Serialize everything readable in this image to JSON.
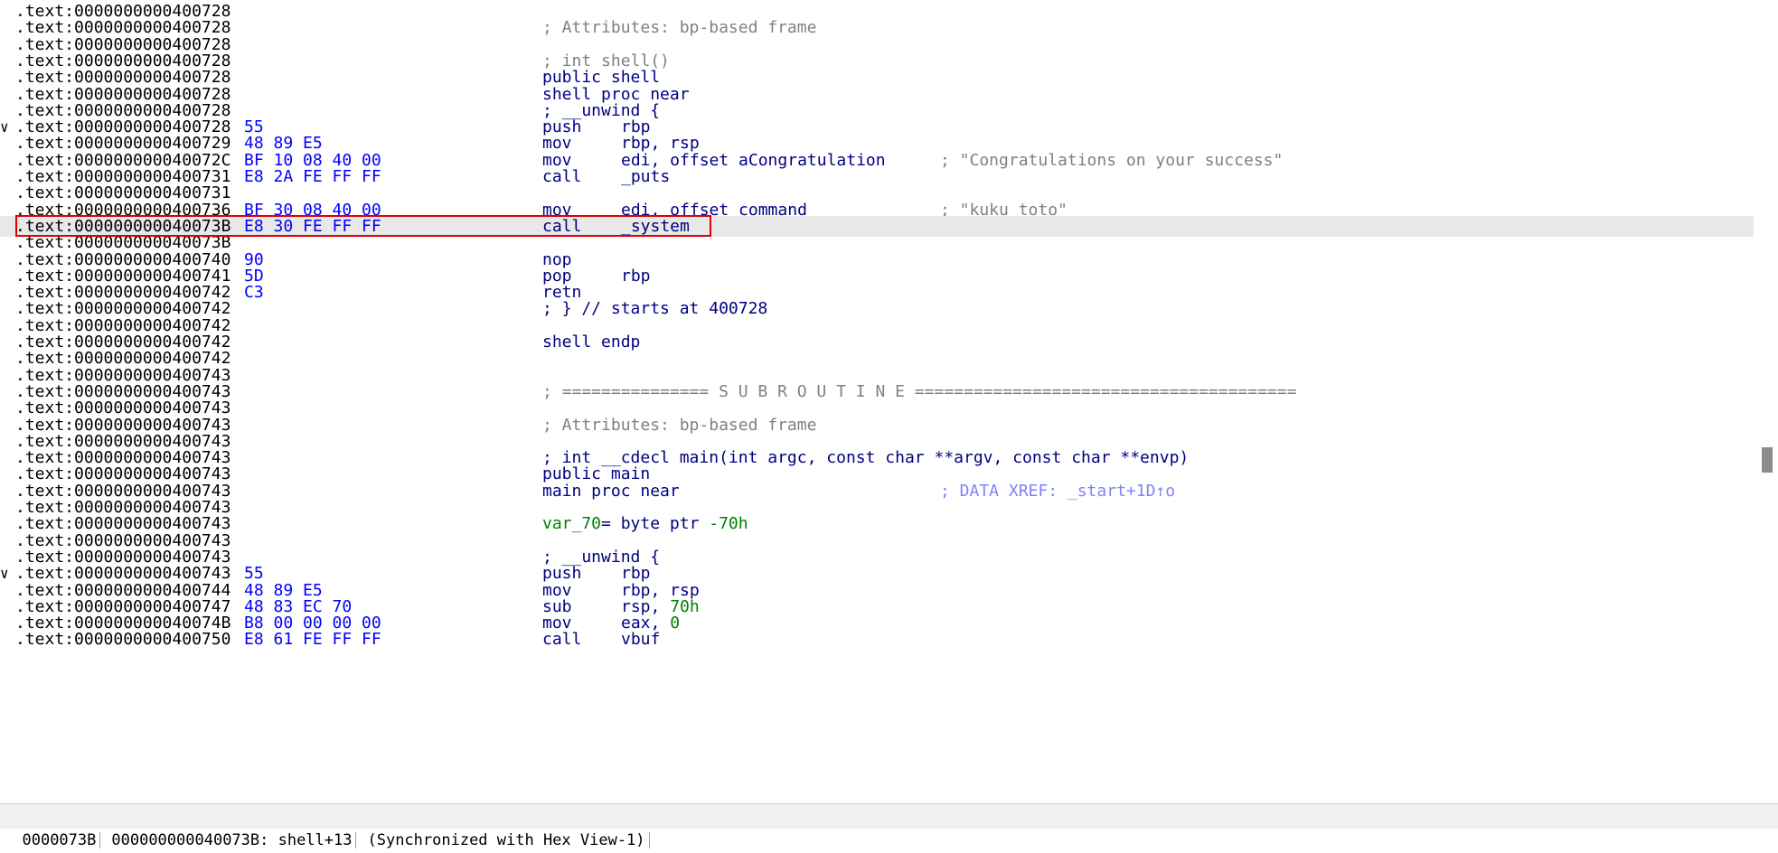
{
  "listing": [
    {
      "addr": ".text:0000000000400728",
      "kind": "blank"
    },
    {
      "addr": ".text:0000000000400728",
      "kind": "comment",
      "text": "; Attributes: bp-based frame"
    },
    {
      "addr": ".text:0000000000400728",
      "kind": "blank"
    },
    {
      "addr": ".text:0000000000400728",
      "kind": "comment",
      "text": "; int shell()"
    },
    {
      "addr": ".text:0000000000400728",
      "kind": "directive",
      "text": "public shell"
    },
    {
      "addr": ".text:0000000000400728",
      "kind": "directive",
      "text": "shell proc near"
    },
    {
      "addr": ".text:0000000000400728",
      "kind": "directive",
      "text": "; __unwind {"
    },
    {
      "addr": ".text:0000000000400728",
      "kind": "insn",
      "arrow": "∨",
      "bytes": "55",
      "mnem": "push",
      "ops": "rbp"
    },
    {
      "addr": ".text:0000000000400729",
      "kind": "insn",
      "bytes": "48 89 E5",
      "mnem": "mov",
      "ops": "rbp, rsp"
    },
    {
      "addr": ".text:000000000040072C",
      "kind": "insn",
      "bytes": "BF 10 08 40 00",
      "mnem": "mov",
      "ops": "edi, offset aCongratulation",
      "cmt": "; \"Congratulations on your success\""
    },
    {
      "addr": ".text:0000000000400731",
      "kind": "insn",
      "bytes": "E8 2A FE FF FF",
      "mnem": "call",
      "ops": "_puts"
    },
    {
      "addr": ".text:0000000000400731",
      "kind": "blank"
    },
    {
      "addr": ".text:0000000000400736",
      "kind": "insn",
      "bytes": "BF 30 08 40 00",
      "mnem": "mov",
      "ops": "edi, offset command",
      "cmt": "; \"kuku toto\""
    },
    {
      "addr": ".text:000000000040073B",
      "kind": "insn",
      "bytes": "E8 30 FE FF FF",
      "mnem": "call",
      "ops": "_system",
      "highlight": true
    },
    {
      "addr": ".text:000000000040073B",
      "kind": "blank"
    },
    {
      "addr": ".text:0000000000400740",
      "kind": "insn",
      "bytes": "90",
      "mnem": "nop",
      "ops": ""
    },
    {
      "addr": ".text:0000000000400741",
      "kind": "insn",
      "bytes": "5D",
      "mnem": "pop",
      "ops": "rbp"
    },
    {
      "addr": ".text:0000000000400742",
      "kind": "insn",
      "bytes": "C3",
      "mnem": "retn",
      "ops": ""
    },
    {
      "addr": ".text:0000000000400742",
      "kind": "directive",
      "text": "; } // starts at 400728"
    },
    {
      "addr": ".text:0000000000400742",
      "kind": "blank"
    },
    {
      "addr": ".text:0000000000400742",
      "kind": "directive",
      "text": "shell endp"
    },
    {
      "addr": ".text:0000000000400742",
      "kind": "blank"
    },
    {
      "addr": ".text:0000000000400743",
      "kind": "blank"
    },
    {
      "addr": ".text:0000000000400743",
      "kind": "comment",
      "text": "; =============== S U B R O U T I N E ======================================="
    },
    {
      "addr": ".text:0000000000400743",
      "kind": "blank"
    },
    {
      "addr": ".text:0000000000400743",
      "kind": "comment",
      "text": "; Attributes: bp-based frame"
    },
    {
      "addr": ".text:0000000000400743",
      "kind": "blank"
    },
    {
      "addr": ".text:0000000000400743",
      "kind": "directive",
      "text": "; int __cdecl main(int argc, const char **argv, const char **envp)"
    },
    {
      "addr": ".text:0000000000400743",
      "kind": "directive",
      "text": "public main"
    },
    {
      "addr": ".text:0000000000400743",
      "kind": "directive",
      "text": "main proc near",
      "xref": "; DATA XREF: _start+1D↑o"
    },
    {
      "addr": ".text:0000000000400743",
      "kind": "blank"
    },
    {
      "addr": ".text:0000000000400743",
      "kind": "var",
      "name": "var_70",
      "rest": "= byte ptr ",
      "val": "-70h"
    },
    {
      "addr": ".text:0000000000400743",
      "kind": "blank"
    },
    {
      "addr": ".text:0000000000400743",
      "kind": "directive",
      "text": "; __unwind {"
    },
    {
      "addr": ".text:0000000000400743",
      "kind": "insn",
      "arrow": "∨",
      "bytes": "55",
      "mnem": "push",
      "ops": "rbp"
    },
    {
      "addr": ".text:0000000000400744",
      "kind": "insn",
      "bytes": "48 89 E5",
      "mnem": "mov",
      "ops": "rbp, rsp"
    },
    {
      "addr": ".text:0000000000400747",
      "kind": "insn",
      "bytes": "48 83 EC 70",
      "mnem": "sub",
      "ops": "rsp, ",
      "imm": "70h"
    },
    {
      "addr": ".text:000000000040074B",
      "kind": "insn",
      "bytes": "B8 00 00 00 00",
      "mnem": "mov",
      "ops": "eax, ",
      "imm": "0"
    },
    {
      "addr": ".text:0000000000400750",
      "kind": "insn",
      "bytes": "E8 61 FE FF FF",
      "mnem": "call",
      "ops": "vbuf"
    }
  ],
  "status": {
    "offset": "0000073B",
    "location": "000000000040073B: shell+13",
    "sync": "(Synchronized with Hex View-1)"
  }
}
